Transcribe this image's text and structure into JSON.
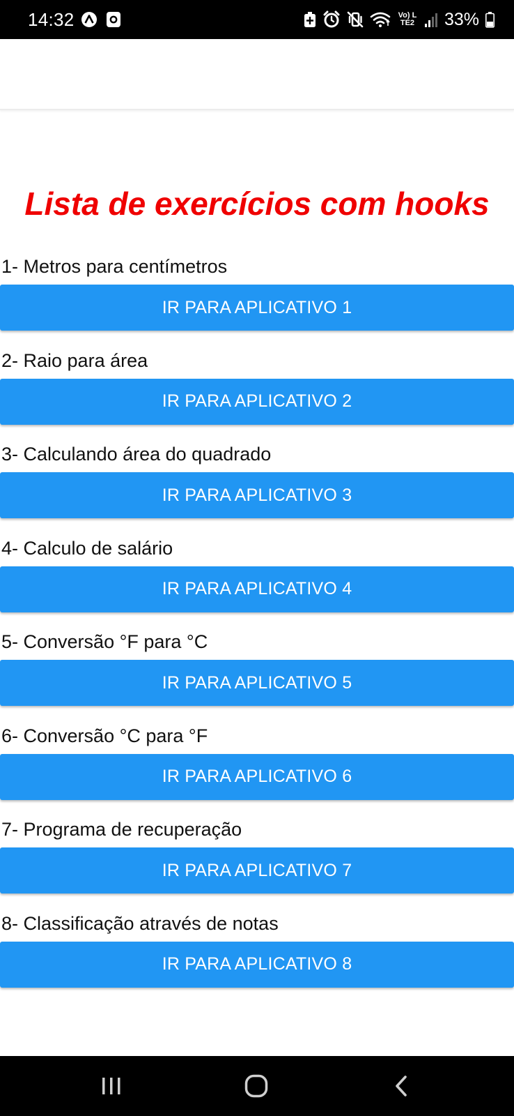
{
  "status_bar": {
    "time": "14:32",
    "battery_percent": "33%",
    "network_label": "Vo) LTE2",
    "left_icons": [
      "app-a-icon",
      "app-square-icon"
    ],
    "right_icons": [
      "battery-saver-icon",
      "alarm-icon",
      "vibrate-icon",
      "wifi-icon",
      "signal-icon",
      "battery-icon"
    ]
  },
  "header": {
    "title": ""
  },
  "page": {
    "title": "Lista de exercícios com hooks",
    "title_color": "#ef0000"
  },
  "exercises": [
    {
      "label": "1- Metros para centímetros",
      "button": "IR PARA APLICATIVO 1"
    },
    {
      "label": "2- Raio para área",
      "button": "IR PARA APLICATIVO 2"
    },
    {
      "label": "3- Calculando área do quadrado",
      "button": "IR PARA APLICATIVO 3"
    },
    {
      "label": "4- Calculo de salário",
      "button": "IR PARA APLICATIVO 4"
    },
    {
      "label": "5- Conversão °F para °C",
      "button": "IR PARA APLICATIVO 5"
    },
    {
      "label": "6- Conversão °C para °F",
      "button": "IR PARA APLICATIVO 6"
    },
    {
      "label": "7- Programa de recuperação",
      "button": "IR PARA APLICATIVO 7"
    },
    {
      "label": "8- Classificação através de notas",
      "button": "IR PARA APLICATIVO 8"
    }
  ],
  "colors": {
    "button_bg": "#2196f3",
    "button_text": "#ffffff",
    "system_bars": "#000000"
  },
  "nav_bar": {
    "icons": [
      "recent-apps-icon",
      "home-icon",
      "back-icon"
    ]
  }
}
